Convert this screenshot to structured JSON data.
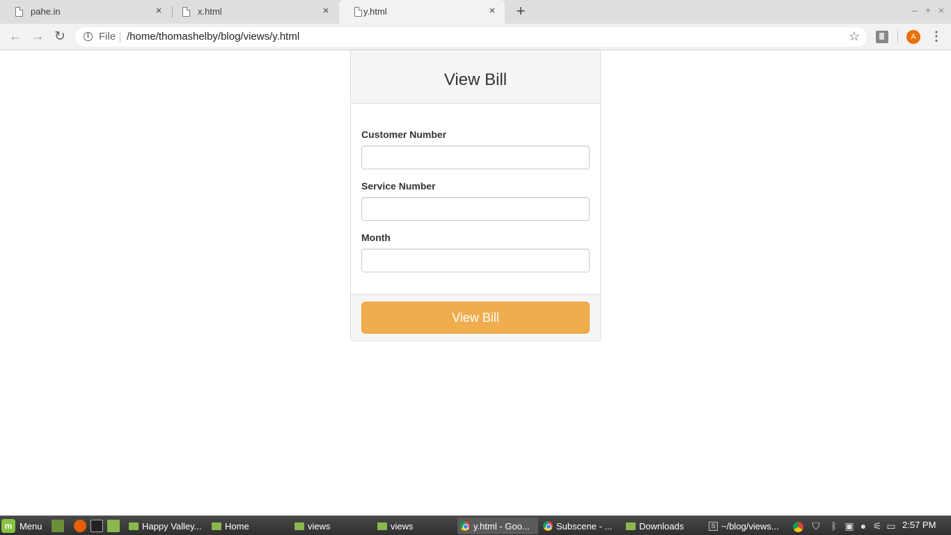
{
  "browser": {
    "tabs": [
      {
        "title": "pahe.in",
        "active": false
      },
      {
        "title": "x.html",
        "active": false
      },
      {
        "title": "y.html",
        "active": true
      }
    ],
    "new_tab_label": "+",
    "window_controls": {
      "minimize": "–",
      "maximize": "+",
      "close": "×"
    },
    "close_tab_glyph": "×",
    "scheme_label": "File",
    "url": "/home/thomashelby/blog/views/y.html",
    "profile_initial": "A",
    "bookmark_star": "☆",
    "menu_glyph": "⋮"
  },
  "page": {
    "heading": "View Bill",
    "fields": [
      {
        "label": "Customer Number",
        "value": "",
        "placeholder": ""
      },
      {
        "label": "Service Number",
        "value": "",
        "placeholder": ""
      },
      {
        "label": "Month",
        "value": "",
        "placeholder": ""
      }
    ],
    "submit_label": "View Bill",
    "colors": {
      "button_bg": "#f0ad4e",
      "button_border": "#eea236",
      "panel_heading_bg": "#f5f5f5"
    }
  },
  "taskbar": {
    "menu_label": "Menu",
    "tasks": [
      {
        "label": "Happy Valley...",
        "icon": "folder-icon"
      },
      {
        "label": "Home",
        "icon": "folder-icon"
      },
      {
        "label": "views",
        "icon": "folder-icon"
      },
      {
        "label": "views",
        "icon": "folder-icon"
      },
      {
        "label": "y.html - Goo...",
        "icon": "chrome-icon",
        "active": true
      },
      {
        "label": "Subscene - ...",
        "icon": "chrome-icon"
      },
      {
        "label": "Downloads",
        "icon": "folder-icon"
      },
      {
        "label": "~/blog/views...",
        "icon": "sublime-icon"
      }
    ],
    "clock": "2:57 PM"
  }
}
